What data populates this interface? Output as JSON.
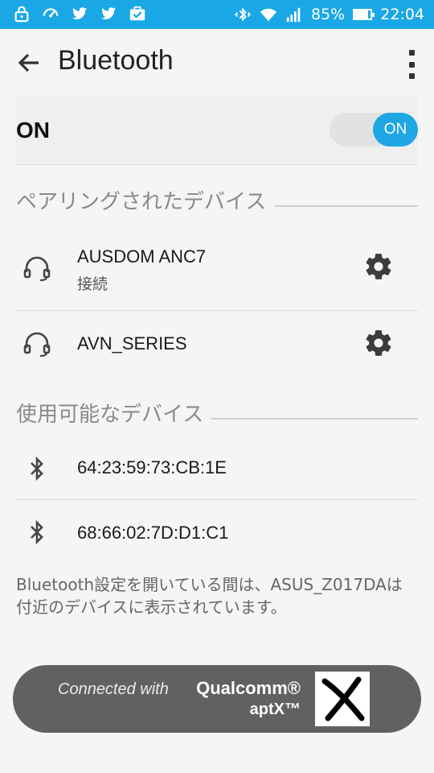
{
  "status_bar": {
    "battery_text": "85%",
    "battery_level": 0.85,
    "time": "22:04",
    "left_icons": [
      "lock-icon",
      "speed-icon",
      "twitter-icon",
      "twitter-icon",
      "briefcase-check-icon"
    ],
    "right_icons": [
      "bluetooth-vibrate-icon",
      "wifi-icon",
      "signal-icon",
      "battery-icon"
    ]
  },
  "app_bar": {
    "title": "Bluetooth"
  },
  "master_switch": {
    "label": "ON",
    "toggle_text": "ON",
    "state": true
  },
  "paired": {
    "title": "ペアリングされたデバイス",
    "devices": [
      {
        "name": "AUSDOM ANC7",
        "status": "接続",
        "icon": "headset-icon"
      },
      {
        "name": "AVN_SERIES",
        "status": "",
        "icon": "headset-icon"
      }
    ]
  },
  "available": {
    "title": "使用可能なデバイス",
    "devices": [
      {
        "name": "64:23:59:73:CB:1E",
        "icon": "bluetooth-icon"
      },
      {
        "name": "68:66:02:7D:D1:C1",
        "icon": "bluetooth-icon"
      }
    ]
  },
  "footer_note": "Bluetooth設定を開いている間は、ASUS_Z017DAは付近のデバイスに表示されています。",
  "aptx_banner": {
    "connected_text": "Connected with",
    "brand_line1": "Qualcomm®",
    "brand_line2": "aptX™"
  },
  "colors": {
    "accent": "#1fa6e5",
    "status_bar": "#1aa7e6",
    "banner": "#616161"
  }
}
